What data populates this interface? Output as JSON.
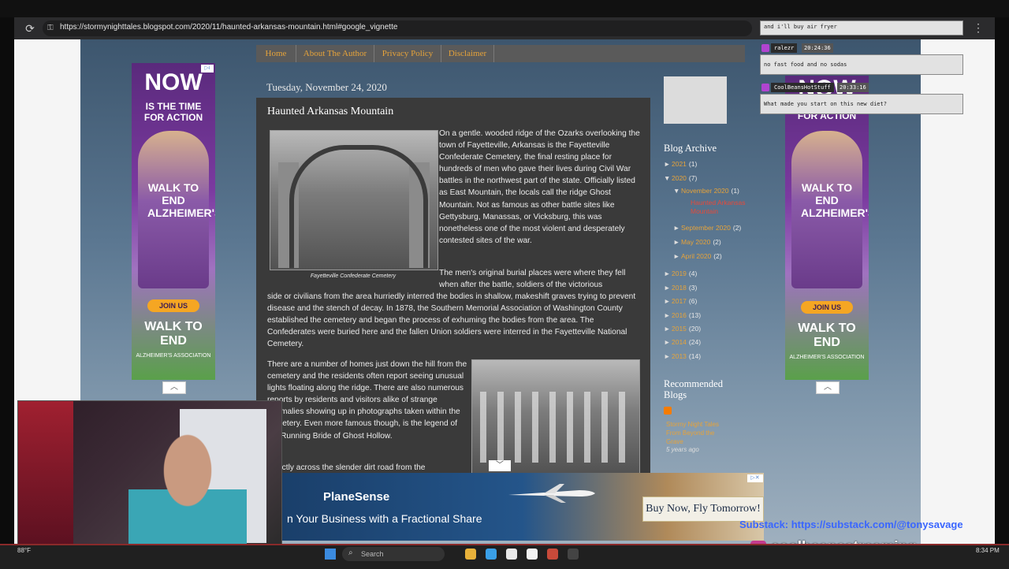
{
  "browser": {
    "url": "https://stormynighttales.blogspot.com/2020/11/haunted-arkansas-mountain.html#google_vignette"
  },
  "nav": {
    "items": [
      "Home",
      "About The Author",
      "Privacy Policy",
      "Disclaimer"
    ]
  },
  "post": {
    "date": "Tuesday, November 24, 2020",
    "title": "Haunted Arkansas Mountain",
    "photo1_caption": "Fayetteville Confederate Cemetery",
    "para1": "On a gentle. wooded ridge of the Ozarks overlooking the town of Fayetteville,  Arkansas is the Fayetteville Confederate Cemetery, the final resting place for hundreds of men who gave their lives during Civil War battles in the northwest part of the state. Officially listed as East Mountain, the locals call the ridge Ghost Mountain. Not as famous as other battle sites like Gettysburg, Manassas, or Vicksburg, this was nonetheless one of the most violent and desperately contested sites of the war.",
    "para2a": "The men's original burial places were where they fell when after the battle, soldiers of the victorious",
    "para2b": "side or civilians from the area hurriedly interred the bodies in shallow, makeshift graves trying to prevent disease and the stench of decay. In 1878, the Southern Memorial Association of Washington County established the cemetery and began the process of exhuming the bodies from the area. The Confederates were buried here and the fallen Union soldiers were interred in the Fayetteville National Cemetery.",
    "para3": "There are a number of homes just down the hill from the cemetery and the residents often report seeing unusual lights floating along the ridge. There are also numerous reports by residents and visitors alike of strange anomalies showing up in photographs taken within the cemetery. Even more famous though, is the legend of the Running Bride of Ghost Hollow.",
    "para4": "Directly across the slender dirt road from the"
  },
  "sidebar": {
    "archive_title": "Blog Archive",
    "archive": [
      {
        "tri": "►",
        "label": "2021",
        "count": "(1)",
        "indent": 0,
        "type": "y"
      },
      {
        "tri": "▼",
        "label": "2020",
        "count": "(7)",
        "indent": 0,
        "type": "y"
      },
      {
        "tri": "▼",
        "label": "November 2020",
        "count": "(1)",
        "indent": 1,
        "type": "y"
      },
      {
        "tri": "",
        "label": "Haunted Arkansas Mountain",
        "count": "",
        "indent": 2,
        "type": "cur"
      },
      {
        "tri": "►",
        "label": "September 2020",
        "count": "(2)",
        "indent": 1,
        "type": "y"
      },
      {
        "tri": "►",
        "label": "May 2020",
        "count": "(2)",
        "indent": 1,
        "type": "y"
      },
      {
        "tri": "►",
        "label": "April 2020",
        "count": "(2)",
        "indent": 1,
        "type": "y"
      },
      {
        "tri": "►",
        "label": "2019",
        "count": "(4)",
        "indent": 0,
        "type": "y"
      },
      {
        "tri": "►",
        "label": "2018",
        "count": "(3)",
        "indent": 0,
        "type": "y"
      },
      {
        "tri": "►",
        "label": "2017",
        "count": "(6)",
        "indent": 0,
        "type": "y"
      },
      {
        "tri": "►",
        "label": "2016",
        "count": "(13)",
        "indent": 0,
        "type": "y"
      },
      {
        "tri": "►",
        "label": "2015",
        "count": "(20)",
        "indent": 0,
        "type": "y"
      },
      {
        "tri": "►",
        "label": "2014",
        "count": "(24)",
        "indent": 0,
        "type": "y"
      },
      {
        "tri": "►",
        "label": "2013",
        "count": "(14)",
        "indent": 0,
        "type": "y"
      }
    ],
    "recommended_title": "Recommended Blogs",
    "recommended_link": "Stormy Night Tales From Beyond the Grave",
    "recommended_age": "5 years ago"
  },
  "ads": {
    "side": {
      "now": "NOW",
      "line2": "IS THE TIME",
      "line3": "FOR ACTION",
      "walk": "WALK TO END ALZHEIMER'S",
      "join": "JOIN US",
      "walk2": "WALK TO END",
      "alz": "ALZHEIMER'S ASSOCIATION"
    },
    "bottom": {
      "logo": "PlaneSense",
      "tagline": "n Your Business with a Fractional Share",
      "cta": "Buy Now, Fly Tomorrow!"
    }
  },
  "chat": [
    {
      "user": "",
      "time": "",
      "message": "and i'll buy air fryer"
    },
    {
      "user": "ralezr",
      "time": "20:24:36",
      "message": "no fast food and no sodas"
    },
    {
      "user": "CoolBeansHotStuff",
      "time": "20:33:16",
      "message": "What made you start on this new diet?"
    }
  ],
  "overlay": {
    "substack": "Substack: https://substack.com/@tonysavage",
    "instagram": "coolbeansstreaming"
  },
  "taskbar": {
    "weather": "88°F",
    "search_placeholder": "Search",
    "clock": "8:34 PM"
  },
  "colors": {
    "accent_orange": "#e6a33a",
    "current_red": "#e64a3a",
    "post_bg": "#3a3a3a"
  }
}
